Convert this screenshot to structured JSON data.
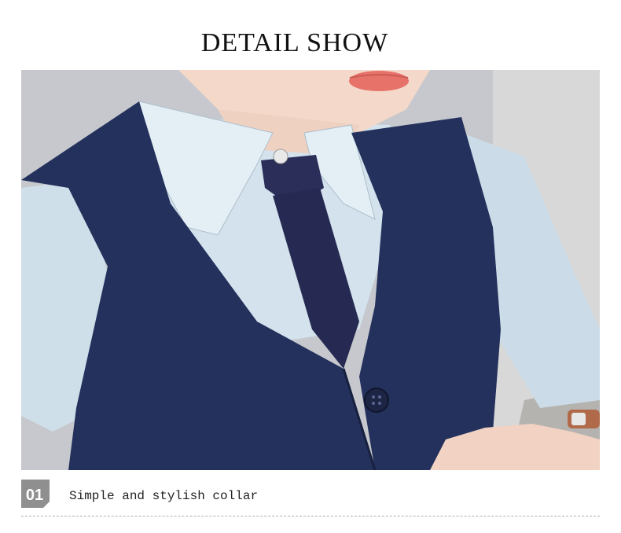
{
  "header": {
    "title": "DETAIL SHOW"
  },
  "detail": {
    "number": "01",
    "caption": "Simple and stylish collar"
  },
  "colors": {
    "vest": "#22305a",
    "shirt": "#c9dbe8",
    "tie": "#262a52",
    "background": "#c8cacf",
    "badge": "#8f8f8f"
  }
}
